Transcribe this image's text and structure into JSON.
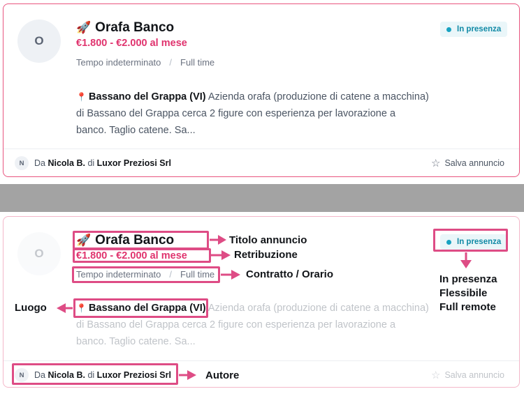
{
  "job": {
    "avatar_letter": "O",
    "rocket": "🚀",
    "title": "Orafa Banco",
    "salary": "€1.800 - €2.000 al mese",
    "contract": "Tempo indeterminato",
    "separator": "/",
    "schedule": "Full time",
    "badge": "In presenza",
    "location": "Bassano del Grappa (VI)",
    "description": "Azienda orafa (produzione di catene a macchina) di Bassano del Grappa cerca 2 figure con esperienza per lavorazione a banco. Taglio catene. Sa...",
    "desc_line1_tail": "Azienda orafa (produzione di catene a macchina)",
    "desc_line2": "di Bassano del Grappa cerca 2 figure con esperienza per lavorazione a",
    "desc_line3": "banco. Taglio catene. Sa...",
    "author_initial": "N",
    "by_prefix": "Da",
    "author": "Nicola B.",
    "of_word": "di",
    "company": "Luxor Preziosi Srl",
    "save_label": "Salva annuncio"
  },
  "annotations": {
    "title": "Titolo annuncio",
    "salary": "Retribuzione",
    "contract": "Contratto / Orario",
    "location": "Luogo",
    "mode_line1": "In presenza",
    "mode_line2": "Flessibile",
    "mode_line3": "Full remote",
    "author": "Autore"
  },
  "colors": {
    "accent": "#e0336e",
    "annotation": "#de4c85",
    "badge_text": "#118aa6"
  }
}
